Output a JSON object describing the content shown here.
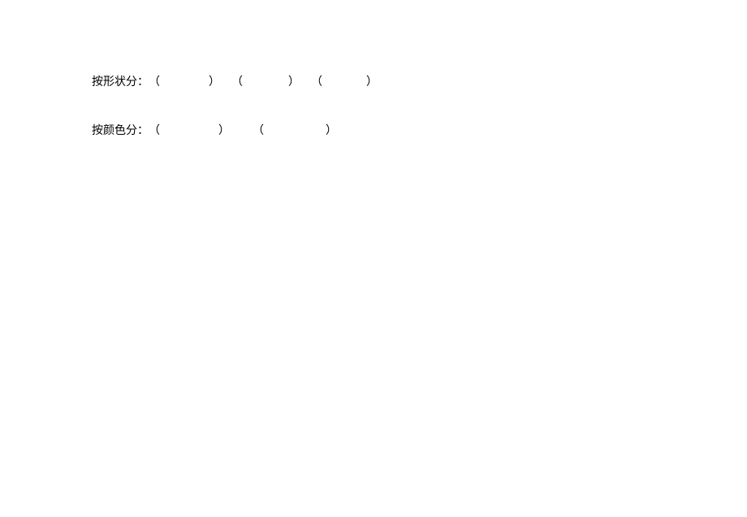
{
  "line1": {
    "label": "按形状分：",
    "blanks": [
      {
        "open": "（",
        "value": "",
        "close": "）"
      },
      {
        "open": "（",
        "value": "",
        "close": "）"
      },
      {
        "open": "（",
        "value": "",
        "close": "）"
      }
    ]
  },
  "line2": {
    "label": "按颜色分：",
    "blanks": [
      {
        "open": "（",
        "value": "",
        "close": "）"
      },
      {
        "open": "（",
        "value": "",
        "close": "）"
      }
    ]
  }
}
